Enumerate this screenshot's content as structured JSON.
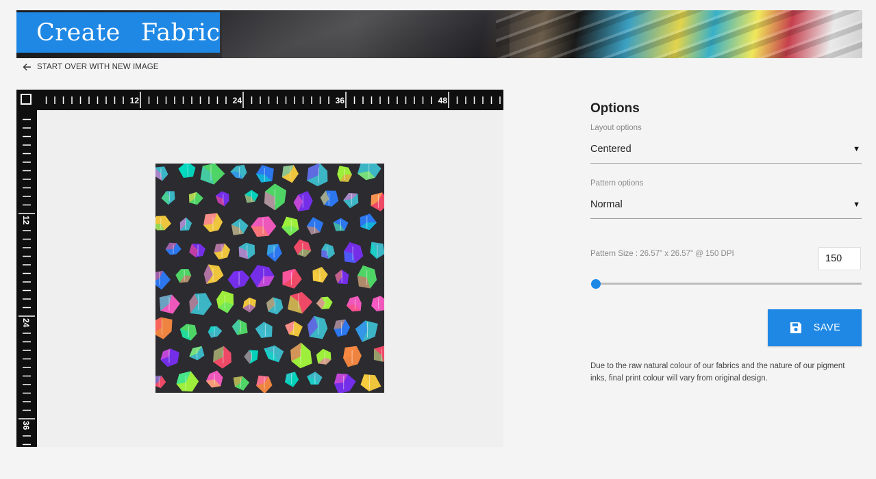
{
  "header": {
    "logo_word1": "Create",
    "logo_word2": "Fabric",
    "brand_color": "#1f88e5"
  },
  "nav": {
    "start_over": "START OVER WITH NEW IMAGE",
    "start_over_icon": "arrow-left-icon"
  },
  "canvas": {
    "ruler_top_labels": [
      "12",
      "24",
      "36",
      "48"
    ],
    "ruler_left_labels": [
      "12",
      "24",
      "36"
    ],
    "corner_icon": "square-icon",
    "preview_description": "rainbow crystal gems pattern on dark background"
  },
  "options": {
    "title": "Options",
    "layout_label": "Layout options",
    "layout_value": "Centered",
    "pattern_label": "Pattern options",
    "pattern_value": "Normal",
    "size_label": "Pattern Size : 26.57\" x 26.57\" @ 150 DPI",
    "dpi_value": "150",
    "slider_level_fraction": 0.0,
    "save_label": "SAVE",
    "save_icon": "floppy-disk-icon",
    "disclaimer": "Due to the raw natural colour of our fabrics and the nature of our pigment inks, final print colour will vary from original design."
  }
}
